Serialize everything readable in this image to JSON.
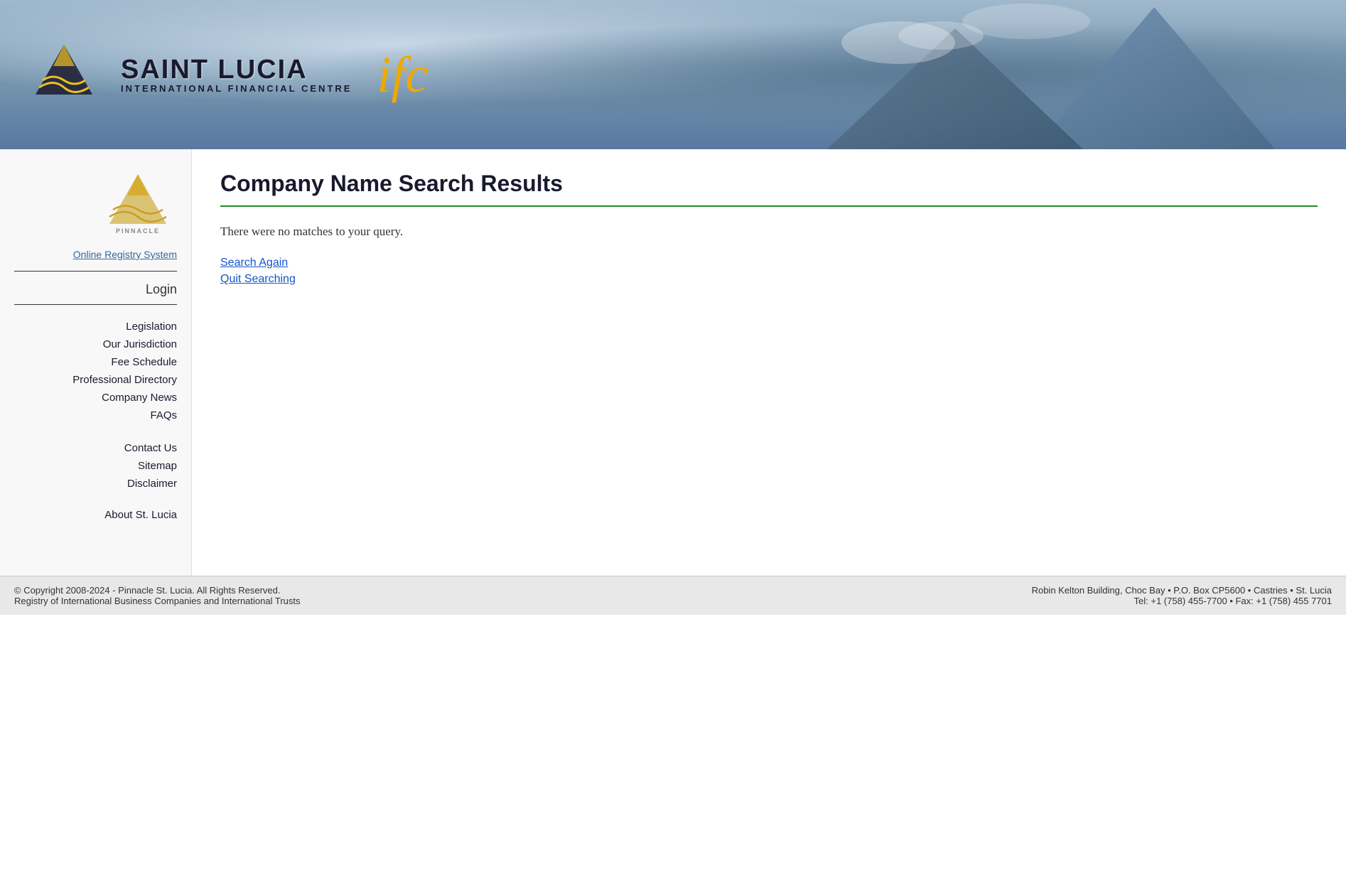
{
  "header": {
    "brand_name": "SAINT LUCIA",
    "brand_subtitle": "INTERNATIONAL FINANCIAL CENTRE",
    "ifc_text": "ifc"
  },
  "sidebar": {
    "registry_label": "Online Registry System",
    "login_label": "Login",
    "nav_primary": [
      {
        "label": "Legislation"
      },
      {
        "label": "Our Jurisdiction"
      },
      {
        "label": "Fee Schedule"
      },
      {
        "label": "Professional Directory"
      },
      {
        "label": "Company News"
      },
      {
        "label": "FAQs"
      }
    ],
    "nav_secondary": [
      {
        "label": "Contact Us"
      },
      {
        "label": "Sitemap"
      },
      {
        "label": "Disclaimer"
      }
    ],
    "about_label": "About St. Lucia"
  },
  "main": {
    "page_title": "Company Name Search Results",
    "no_matches_text": "There were no matches to your query.",
    "search_again_label": "Search Again",
    "quit_searching_label": "Quit Searching"
  },
  "footer": {
    "copyright": "© Copyright 2008-2024 - Pinnacle St. Lucia. All Rights Reserved.",
    "registry_info": "Registry of International Business Companies and International Trusts",
    "address": "Robin Kelton Building, Choc Bay • P.O. Box CP5600 • Castries • St. Lucia",
    "contact": "Tel: +1 (758) 455-7700 • Fax: +1 (758) 455 7701"
  }
}
